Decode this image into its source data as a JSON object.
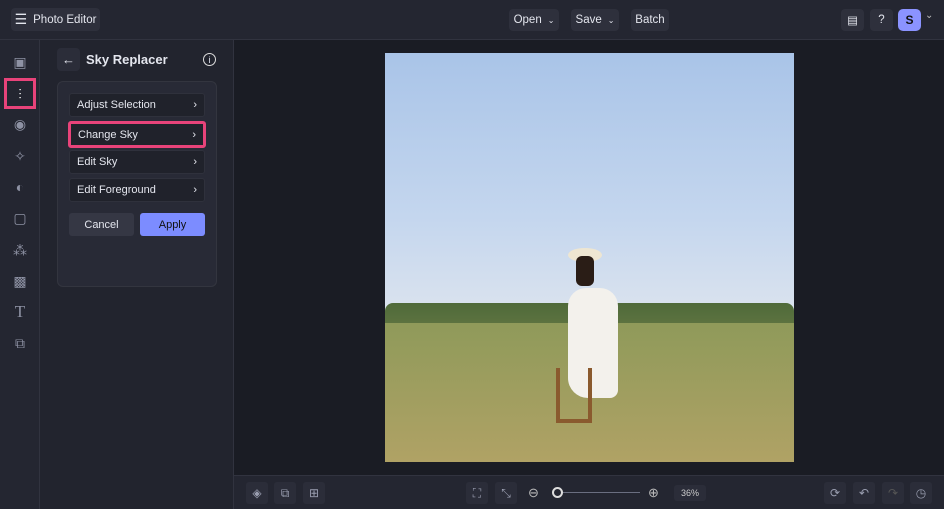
{
  "app": {
    "title": "Photo Editor",
    "avatar": "S"
  },
  "toolbar": {
    "open": "Open",
    "save": "Save",
    "batch": "Batch"
  },
  "panel": {
    "title": "Sky Replacer",
    "items": [
      {
        "label": "Adjust Selection"
      },
      {
        "label": "Change Sky"
      },
      {
        "label": "Edit Sky"
      },
      {
        "label": "Edit Foreground"
      }
    ],
    "cancel": "Cancel",
    "apply": "Apply"
  },
  "zoom": {
    "level": "36%",
    "fraction": 0.1
  },
  "colors": {
    "accent": "#7c8cff",
    "highlight": "#e8437a"
  }
}
